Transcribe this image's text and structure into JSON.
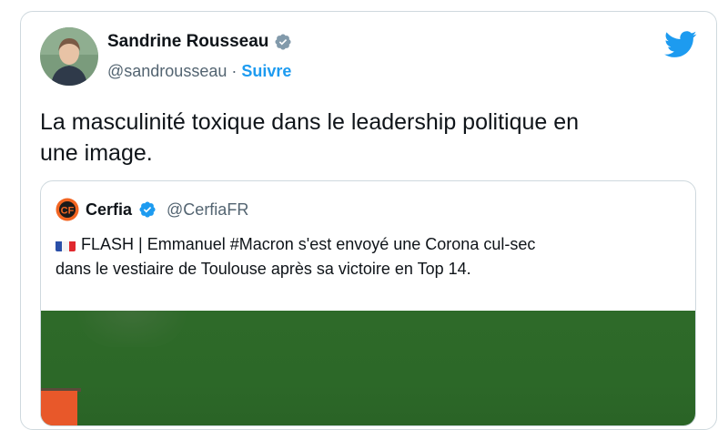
{
  "author": {
    "name": "Sandrine Rousseau",
    "handle": "@sandrousseau",
    "separator": "·",
    "follow_label": "Suivre"
  },
  "tweet": {
    "text_line1": "La masculinité toxique dans le leadership politique en",
    "text_line2": "une image."
  },
  "quoted": {
    "name": "Cerfia",
    "handle": "@CerfiaFR",
    "text_line1": "FLASH | Emmanuel #Macron s'est envoyé une Corona cul-sec",
    "text_line2": "dans le vestiaire de Toulouse après sa victoire en Top 14."
  },
  "colors": {
    "accent": "#1d9bf0",
    "border": "#cfd9de",
    "secondary_text": "#536471",
    "media_green": "#2e6a29",
    "cerfia_orange": "#f26522"
  },
  "icons": {
    "verified": "verified-badge-icon",
    "platform": "twitter-bird-icon",
    "quoted_logo": "cerfia-logo-icon",
    "flag": "french-flag-icon"
  }
}
